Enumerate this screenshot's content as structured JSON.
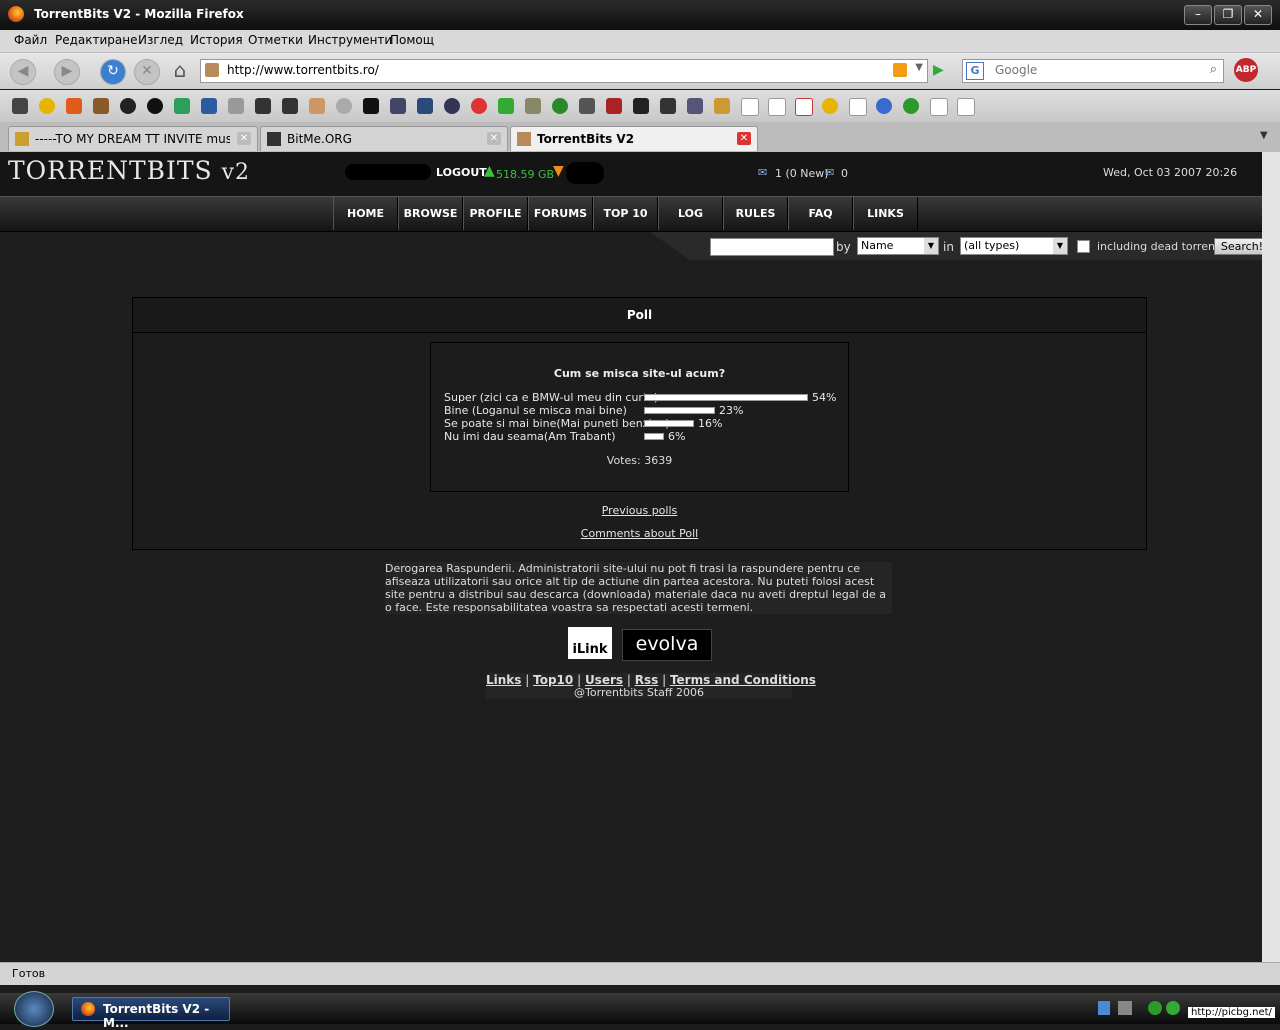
{
  "window": {
    "title": "TorrentBits V2 - Mozilla Firefox"
  },
  "menu": [
    "Файл",
    "Редактиране",
    "Изглед",
    "История",
    "Отметки",
    "Инструменти",
    "Помощ"
  ],
  "nav": {
    "url": "http://www.torrentbits.ro/",
    "search_placeholder": "Google"
  },
  "tabs": [
    {
      "label": "-----TO MY DREAM TT INVITE music sit..."
    },
    {
      "label": "BitMe.ORG"
    },
    {
      "label": "TorrentBits V2"
    }
  ],
  "site": {
    "logo_main": "TorrentBits",
    "logo_suffix": "V2",
    "logout": "LOGOUT",
    "upload": "518.59 GB",
    "messages": "1 (0 New)",
    "messages_out": "0",
    "datetime": "Wed, Oct 03 2007 20:26",
    "nav_links": [
      "HOME",
      "BROWSE",
      "PROFILE",
      "FORUMS",
      "TOP 10",
      "LOG",
      "RULES",
      "FAQ",
      "LINKS"
    ],
    "search": {
      "by_label": "by",
      "by_value": "Name",
      "in_label": "in",
      "in_value": "(all types)",
      "dead_label": "including dead torrents",
      "button": "Search!"
    }
  },
  "poll": {
    "heading": "Poll",
    "question": "Cum se misca site-ul acum?",
    "options": [
      {
        "label": "Super (zici ca e BMW-ul meu din curte)",
        "percent": 54,
        "percent_text": "54%"
      },
      {
        "label": "Bine (Loganul se misca mai bine)",
        "percent": 23,
        "percent_text": "23%"
      },
      {
        "label": "Se poate si mai bine(Mai puneti benzina)",
        "percent": 16,
        "percent_text": "16%"
      },
      {
        "label": "Nu imi dau seama(Am Trabant)",
        "percent": 6,
        "percent_text": "6%"
      }
    ],
    "votes": "Votes: 3639",
    "previous_link": "Previous polls",
    "comments_link": "Comments about Poll"
  },
  "disclaimer": "Derogarea Raspunderii. Administratorii site-ului nu pot fi trasi la raspundere pentru ce afiseaza utilizatorii sau orice alt tip de actiune din partea acestora. Nu puteti folosi acest site pentru a distribui sau descarca (downloada) materiale daca nu aveti dreptul legal de a o face. Este responsabilitatea voastra sa respectati acesti termeni.",
  "sponsors": {
    "ilink": "iLink",
    "evolva": "evolva"
  },
  "footer": {
    "links": [
      "Links",
      "Top10",
      "Users",
      "Rss",
      "Terms and Conditions"
    ],
    "credit": "@Torrentbits Staff 2006"
  },
  "status": "Готов",
  "taskbar": {
    "item": "TorrentBits V2 - M...",
    "watermark": "http://picbg.net/"
  },
  "colors": {
    "green": "#3fbf3f",
    "orange": "#f08a1a"
  }
}
